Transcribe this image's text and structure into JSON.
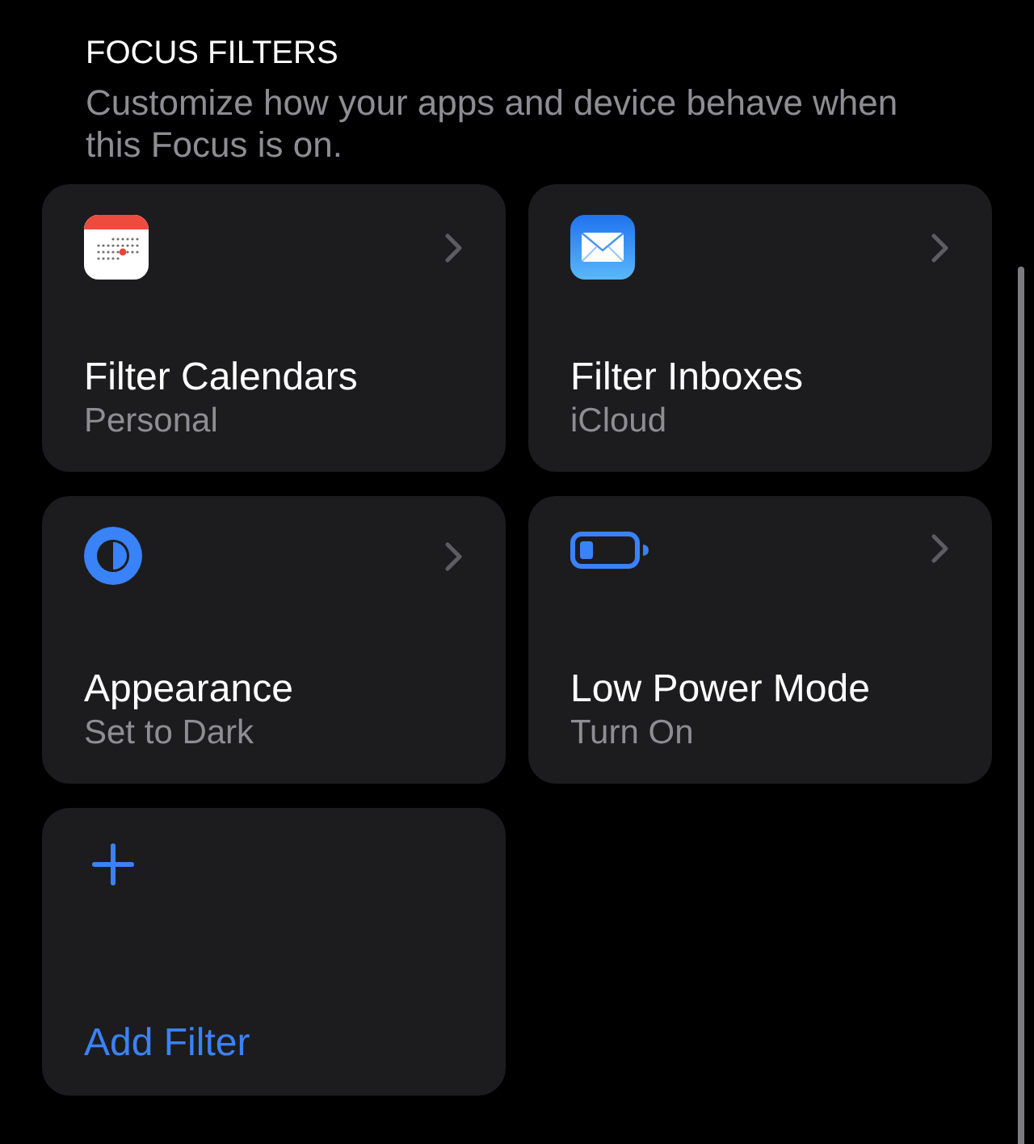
{
  "section": {
    "heading": "FOCUS FILTERS",
    "description": "Customize how your apps and device behave when this Focus is on."
  },
  "filters": [
    {
      "title": "Filter Calendars",
      "subtitle": "Personal"
    },
    {
      "title": "Filter Inboxes",
      "subtitle": "iCloud"
    },
    {
      "title": "Appearance",
      "subtitle": "Set to Dark"
    },
    {
      "title": "Low Power Mode",
      "subtitle": "Turn On"
    }
  ],
  "add_filter": {
    "label": "Add Filter"
  }
}
